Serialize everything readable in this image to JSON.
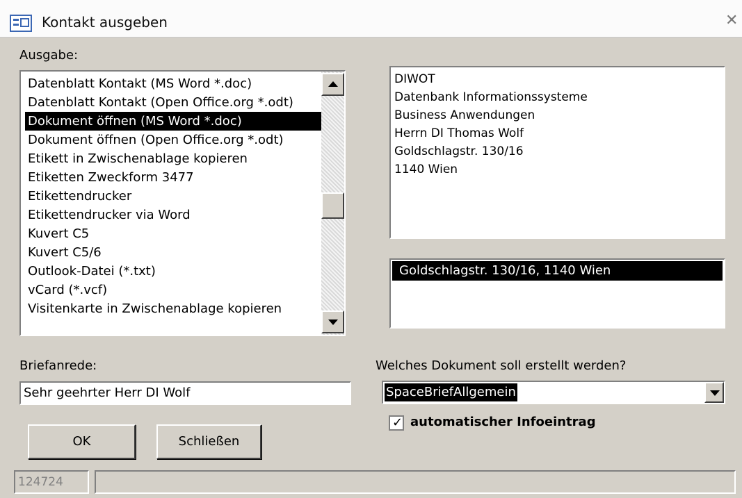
{
  "window": {
    "title": "Kontakt ausgeben",
    "close_icon": "✕"
  },
  "output": {
    "label": "Ausgabe:",
    "items": [
      "Datenblatt Kontakt (MS Word *.doc)",
      "Datenblatt Kontakt (Open Office.org *.odt)",
      "Dokument öffnen (MS Word *.doc)",
      "Dokument öffnen (Open Office.org *.odt)",
      "Etikett in Zwischenablage kopieren",
      "Etiketten Zweckform 3477",
      "Etikettendrucker",
      "Etikettendrucker via Word",
      "Kuvert C5",
      "Kuvert C5/6",
      "Outlook-Datei (*.txt)",
      "vCard (*.vcf)",
      "Visitenkarte in Zwischenablage kopieren"
    ],
    "selected": "Dokument öffnen (MS Word *.doc)"
  },
  "address": {
    "lines": [
      "DIWOT",
      "Datenbank Informationssysteme",
      "Business Anwendungen",
      "Herrn DI Thomas Wolf",
      "Goldschlagstr. 130/16",
      "1140 Wien"
    ],
    "selected_address": "Goldschlagstr. 130/16, 1140 Wien"
  },
  "salutation": {
    "label": "Briefanrede:",
    "value": "Sehr geehrter Herr DI Wolf"
  },
  "document": {
    "label": "Welches Dokument soll erstellt werden?",
    "value": "SpaceBriefAllgemein",
    "auto_entry_label": "automatischer Infoeintrag",
    "auto_entry_checked": true,
    "check_mark": "✓"
  },
  "buttons": {
    "ok": "OK",
    "close": "Schließen"
  },
  "status": {
    "id": "124724",
    "message": ""
  }
}
